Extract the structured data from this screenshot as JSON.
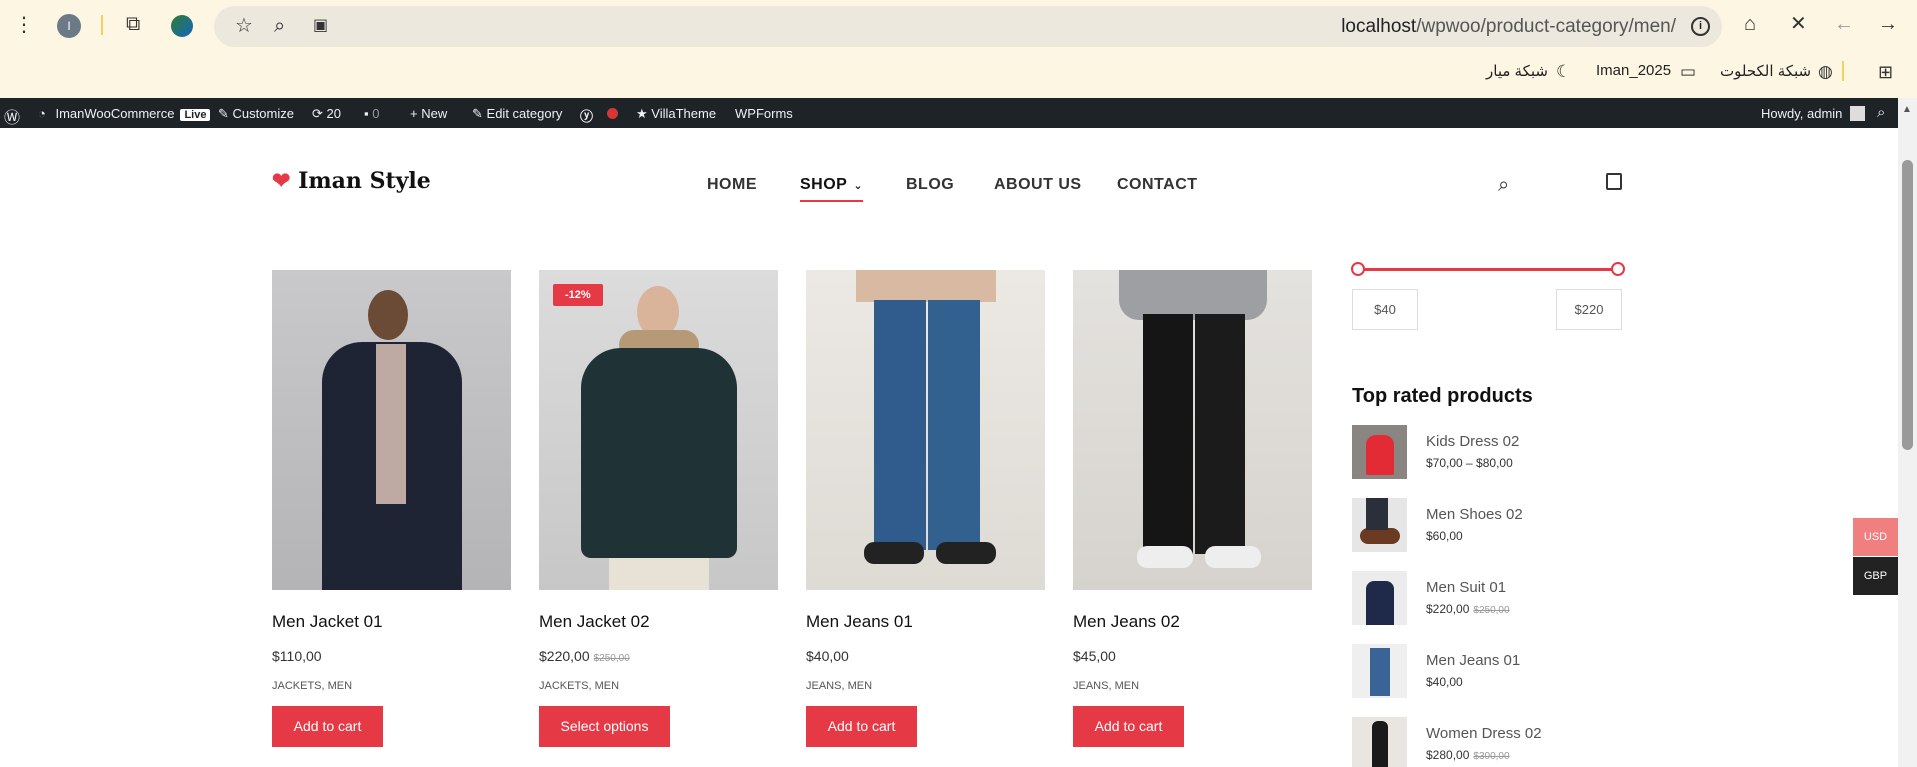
{
  "browser": {
    "url_host": "localhost",
    "url_path": "/wpwoo/product-category/men/",
    "avatar_letter": "I",
    "bookmarks": [
      "شبكة الكحلوت",
      "Iman_2025",
      "شبكة ميار"
    ]
  },
  "wp_admin_bar": {
    "site_name": "ImanWooCommerce",
    "live_label": "Live",
    "customize": "Customize",
    "updates_count": "20",
    "comments_count": "0",
    "new_label": "New",
    "edit_category": "Edit category",
    "villatheme": "VillaTheme",
    "wpforms": "WPForms",
    "howdy": "Howdy, admin"
  },
  "site": {
    "logo_text": "Iman Style",
    "nav": [
      "HOME",
      "SHOP",
      "BLOG",
      "ABOUT US",
      "CONTACT"
    ]
  },
  "products": [
    {
      "name": "Men Jacket 01",
      "price": "$110,00",
      "old_price": "",
      "categories": "JACKETS, MEN",
      "button": "Add to cart",
      "badge": ""
    },
    {
      "name": "Men Jacket 02",
      "price": "$220,00",
      "old_price": "$250,00",
      "categories": "JACKETS, MEN",
      "button": "Select options",
      "badge": "-12%"
    },
    {
      "name": "Men Jeans 01",
      "price": "$40,00",
      "old_price": "",
      "categories": "JEANS, MEN",
      "button": "Add to cart",
      "badge": ""
    },
    {
      "name": "Men Jeans 02",
      "price": "$45,00",
      "old_price": "",
      "categories": "JEANS, MEN",
      "button": "Add to cart",
      "badge": ""
    }
  ],
  "price_filter": {
    "min": "$40",
    "max": "$220"
  },
  "top_rated": {
    "title": "Top rated products",
    "items": [
      {
        "name": "Kids Dress 02",
        "price": "$70,00 – $80,00",
        "old_price": ""
      },
      {
        "name": "Men Shoes 02",
        "price": "$60,00",
        "old_price": ""
      },
      {
        "name": "Men Suit 01",
        "price": "$220,00",
        "old_price": "$250,00"
      },
      {
        "name": "Men Jeans 01",
        "price": "$40,00",
        "old_price": ""
      },
      {
        "name": "Women Dress 02",
        "price": "$280,00",
        "old_price": "$300,00"
      }
    ]
  },
  "currency_switcher": [
    "USD",
    "GBP"
  ],
  "colors": {
    "accent": "#e63946",
    "admin_bar": "#1d2327",
    "chrome_bg": "#fdf6e3"
  }
}
